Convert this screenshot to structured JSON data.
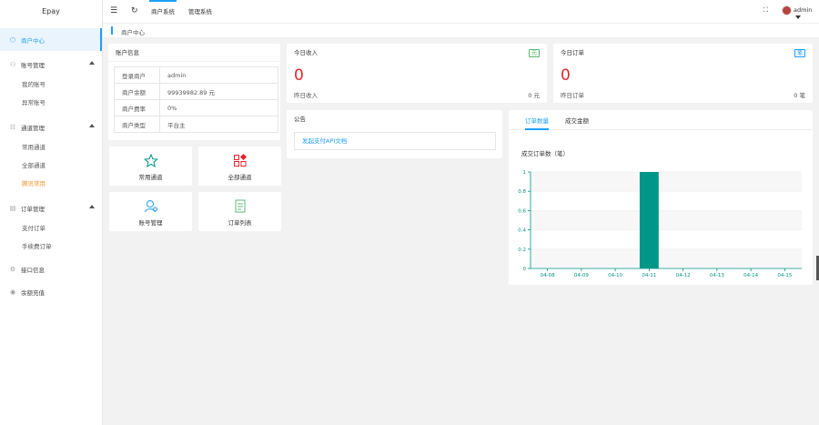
{
  "app": {
    "logo": "Epay"
  },
  "sidebar": {
    "items": [
      {
        "label": "商户中心",
        "icon": "home-icon",
        "active": true
      },
      {
        "label": "账号管理",
        "icon": "user-icon",
        "sub": [
          "我的账号",
          "异常账号"
        ]
      },
      {
        "label": "通道管理",
        "icon": "channel-icon",
        "sub": [
          "常用通道",
          "全部通道",
          "腾讯常用"
        ]
      },
      {
        "label": "订单管理",
        "icon": "order-icon",
        "sub": [
          "支付订单",
          "手续费订单"
        ]
      },
      {
        "label": "接口信息",
        "icon": "api-icon"
      },
      {
        "label": "余额充值",
        "icon": "wallet-icon"
      }
    ]
  },
  "header": {
    "tabs": [
      "商户系统",
      "管理系统"
    ],
    "user": "admin"
  },
  "breadcrumb": "商户中心",
  "account": {
    "title": "账户信息",
    "rows": [
      {
        "k": "登录商户",
        "v": "admin"
      },
      {
        "k": "商户余额",
        "v": "99939982.89 元"
      },
      {
        "k": "商户费率",
        "v": "0%"
      },
      {
        "k": "商户类型",
        "v": "平台主"
      }
    ]
  },
  "shortcuts": [
    "常用通道",
    "全部通道",
    "账号管理",
    "订单列表"
  ],
  "income": {
    "title": "今日收入",
    "badge": "元",
    "value": "0",
    "sub_label": "昨日收入",
    "sub_value": "0 元",
    "badge_color": "#5fb878"
  },
  "orders": {
    "title": "今日订单",
    "badge": "笔",
    "value": "0",
    "sub_label": "昨日订单",
    "sub_value": "0 笔",
    "badge_color": "#1e9fff"
  },
  "notice": {
    "title": "公告",
    "link": "发起支付API文档"
  },
  "chart_tabs": [
    "订单数量",
    "成交金额"
  ],
  "chart_data": {
    "type": "bar",
    "title": "成交订单数（笔）",
    "categories": [
      "04-08",
      "04-09",
      "04-10",
      "04-11",
      "04-12",
      "04-13",
      "04-14",
      "04-15"
    ],
    "values": [
      0,
      0,
      0,
      1,
      0,
      0,
      0,
      0
    ],
    "ylim": [
      0,
      1
    ],
    "yticks": [
      "0",
      "0.2",
      "0.4",
      "0.6",
      "0.8",
      "1"
    ],
    "bar_color": "#009688",
    "axis_color": "#009688"
  }
}
